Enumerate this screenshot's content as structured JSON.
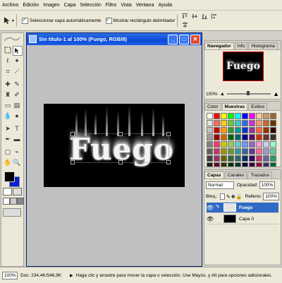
{
  "menu": [
    "Archivo",
    "Edición",
    "Imagen",
    "Capa",
    "Selección",
    "Filtro",
    "Vista",
    "Ventana",
    "Ayuda"
  ],
  "options": {
    "auto_select": "Seleccionar capa automáticamente",
    "show_bounds": "Mostrar rectángulo delimitador"
  },
  "document": {
    "title": "Sin título-1 al 100% (Fuego, RGB/8)",
    "art_text": "Fuego"
  },
  "navigator": {
    "tabs": [
      "Navegador",
      "Info",
      "Histograma"
    ],
    "preview_text": "Fuego",
    "zoom": "100%"
  },
  "swatches_panel": {
    "tabs": [
      "Color",
      "Muestras",
      "Estilos"
    ],
    "colors": [
      "#ffffff",
      "#ff0000",
      "#ffff00",
      "#00ff00",
      "#00ffff",
      "#0000ff",
      "#ff00ff",
      "#ffcc99",
      "#cc9966",
      "#996633",
      "#e0e0e0",
      "#ff6666",
      "#ffcc00",
      "#66cc33",
      "#33cccc",
      "#3366ff",
      "#cc33cc",
      "#ff9966",
      "#cc6633",
      "#663300",
      "#c0c0c0",
      "#cc0000",
      "#ff9900",
      "#339933",
      "#009999",
      "#0033cc",
      "#993399",
      "#ff6633",
      "#993300",
      "#330000",
      "#a0a0a0",
      "#990000",
      "#cc6600",
      "#006600",
      "#006666",
      "#000099",
      "#660066",
      "#cc3300",
      "#663333",
      "#333333",
      "#808080",
      "#ff3366",
      "#cccc00",
      "#99cc66",
      "#66cccc",
      "#6699ff",
      "#9966cc",
      "#ff99cc",
      "#ccccff",
      "#99ffcc",
      "#606060",
      "#cc3366",
      "#999900",
      "#669933",
      "#339999",
      "#336699",
      "#663399",
      "#ff6699",
      "#9999cc",
      "#66cc99",
      "#404040",
      "#993366",
      "#666600",
      "#336633",
      "#336666",
      "#003366",
      "#330066",
      "#cc3366",
      "#666699",
      "#339966",
      "#202020",
      "#660033",
      "#333300",
      "#003300",
      "#003333",
      "#000033",
      "#330033",
      "#990033",
      "#333366",
      "#006633",
      "#101010",
      "#ff0066",
      "#ffff66",
      "#00ff99",
      "#66ffff",
      "#0099ff",
      "#cc66ff",
      "#ff3399",
      "#ccff66",
      "#99ccff",
      "#000000",
      "#cc0066",
      "#ffcc66",
      "#33ff66",
      "#00cccc",
      "#0066ff",
      "#9933ff",
      "#ff0099",
      "#99ff33",
      "#6699cc"
    ]
  },
  "layers_panel": {
    "tabs": [
      "Capas",
      "Canales",
      "Trazados"
    ],
    "blend_mode": "Normal",
    "opacity_label": "Opacidad:",
    "opacity_value": "100%",
    "lock_label": "Bloq.:",
    "fill_label": "Relleno:",
    "fill_value": "100%",
    "layers": [
      {
        "name": "Fuego",
        "selected": true
      },
      {
        "name": "Capa 0",
        "selected": false
      }
    ]
  },
  "status": {
    "zoom": "100%",
    "doc": "Doc: 234,4K/546,9K",
    "hint": "Haga clic y arrastre para mover la capa o selección. Use Mayús. y Alt para opciones adicionales."
  }
}
